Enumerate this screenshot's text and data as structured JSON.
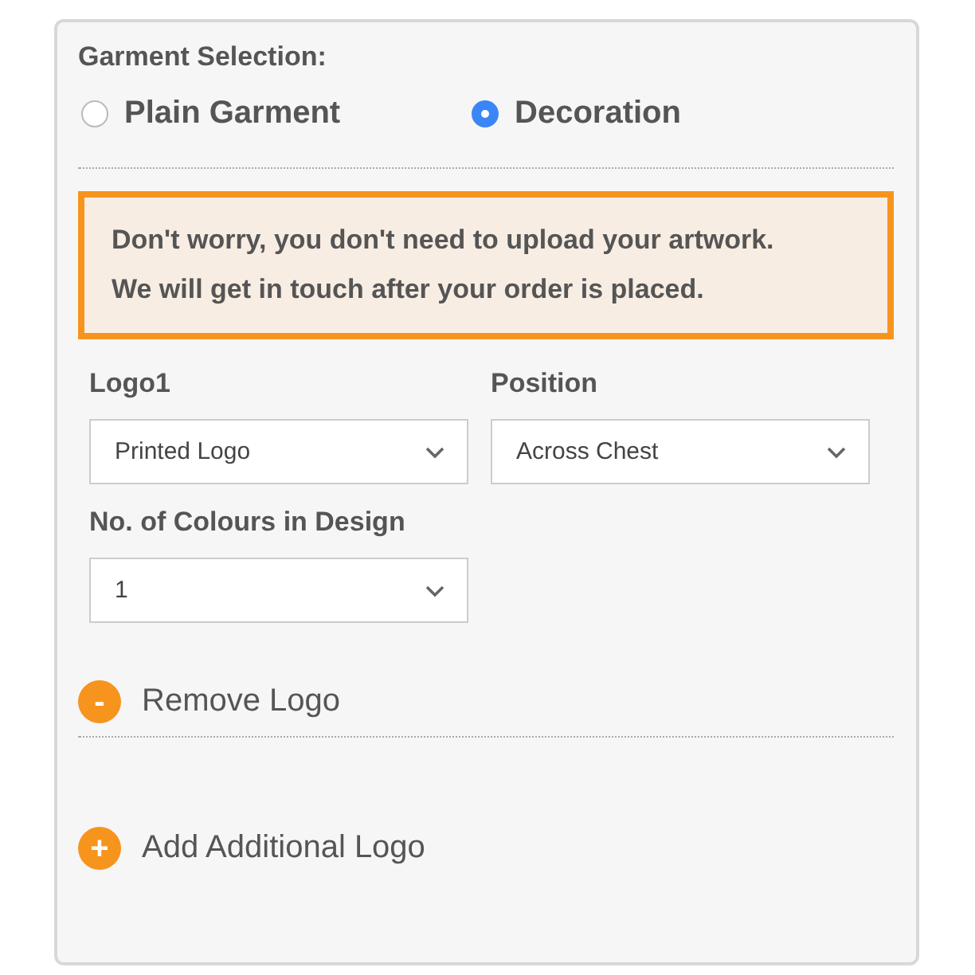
{
  "garment_selection": {
    "title": "Garment Selection:",
    "options": [
      {
        "label": "Plain Garment",
        "selected": false
      },
      {
        "label": "Decoration",
        "selected": true
      }
    ]
  },
  "notice": {
    "lines": [
      "Don't worry, you don't need to upload your artwork.",
      "We will get in touch after your order is placed."
    ]
  },
  "logo_fields": [
    {
      "label": "Logo1",
      "value": "Printed Logo"
    },
    {
      "label": "Position",
      "value": "Across Chest"
    },
    {
      "label": "No. of Colours in Design",
      "value": "1"
    }
  ],
  "remove_logo": {
    "symbol": "-",
    "label": "Remove Logo"
  },
  "add_logo": {
    "symbol": "+",
    "label": "Add Additional Logo"
  }
}
